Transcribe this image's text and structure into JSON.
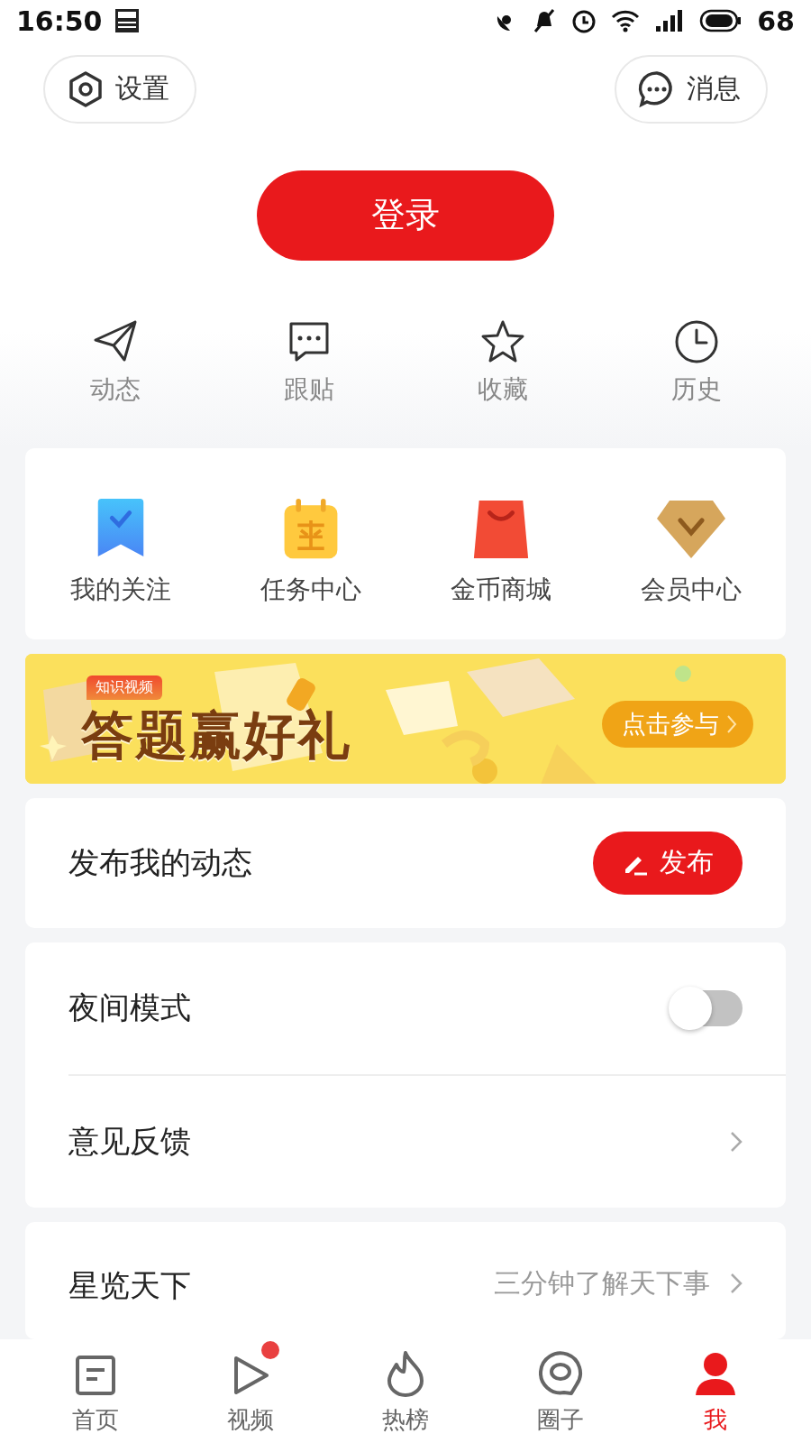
{
  "status_bar": {
    "time": "16:50",
    "battery": "68"
  },
  "header": {
    "settings": "设置",
    "messages": "消息"
  },
  "login_button": "登录",
  "quick_actions": [
    {
      "label": "动态",
      "kind": "send"
    },
    {
      "label": "跟贴",
      "kind": "comment"
    },
    {
      "label": "收藏",
      "kind": "star"
    },
    {
      "label": "历史",
      "kind": "clock"
    }
  ],
  "services": [
    {
      "label": "我的关注",
      "kind": "follow"
    },
    {
      "label": "任务中心",
      "kind": "task"
    },
    {
      "label": "金币商城",
      "kind": "shop"
    },
    {
      "label": "会员中心",
      "kind": "vip"
    }
  ],
  "banner": {
    "tag": "知识视频",
    "title": "答题赢好礼",
    "button": "点击参与"
  },
  "post_card": {
    "label": "发布我的动态",
    "button": "发布"
  },
  "settings_list": [
    {
      "label": "夜间模式",
      "kind": "toggle",
      "on": false
    },
    {
      "label": "意见反馈",
      "kind": "link"
    }
  ],
  "partial_card": {
    "label": "星览天下",
    "hint": "三分钟了解天下事"
  },
  "bottom_nav": [
    {
      "label": "首页",
      "kind": "home",
      "selected": false,
      "badge": false
    },
    {
      "label": "视频",
      "kind": "video",
      "selected": false,
      "badge": true
    },
    {
      "label": "热榜",
      "kind": "hot",
      "selected": false,
      "badge": false
    },
    {
      "label": "圈子",
      "kind": "circle",
      "selected": false,
      "badge": false
    },
    {
      "label": "我",
      "kind": "me",
      "selected": true,
      "badge": false
    }
  ]
}
